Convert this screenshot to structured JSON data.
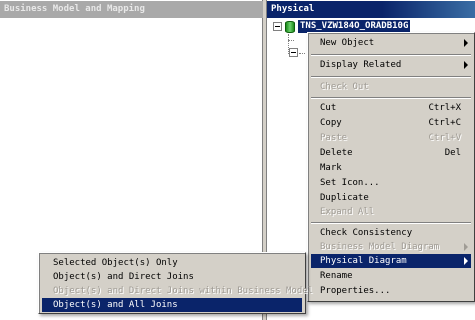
{
  "left_pane": {
    "title": "Business Model and Mapping"
  },
  "right_pane": {
    "title": "Physical",
    "tree": {
      "selected_node": "TNS_VZW184O_ORADB10G"
    }
  },
  "context_menu": {
    "items": [
      {
        "label": "New Object",
        "submenu": true,
        "disabled": false
      },
      {
        "label": "Display Related",
        "submenu": true,
        "disabled": false
      },
      {
        "label": "Check Out",
        "disabled": true
      },
      {
        "label": "Cut",
        "shortcut": "Ctrl+X",
        "disabled": false
      },
      {
        "label": "Copy",
        "shortcut": "Ctrl+C",
        "disabled": false
      },
      {
        "label": "Paste",
        "shortcut": "Ctrl+V",
        "disabled": true
      },
      {
        "label": "Delete",
        "shortcut": "Del",
        "disabled": false
      },
      {
        "label": "Mark",
        "disabled": false
      },
      {
        "label": "Set Icon...",
        "disabled": false
      },
      {
        "label": "Duplicate",
        "disabled": false
      },
      {
        "label": "Expand All",
        "disabled": true
      },
      {
        "label": "Check Consistency",
        "disabled": false
      },
      {
        "label": "Business Model Diagram",
        "submenu": true,
        "disabled": true
      },
      {
        "label": "Physical Diagram",
        "submenu": true,
        "highlighted": true
      },
      {
        "label": "Rename",
        "disabled": false
      },
      {
        "label": "Properties...",
        "disabled": false
      }
    ]
  },
  "sub_menu": {
    "items": [
      {
        "label": "Selected Object(s) Only",
        "disabled": false
      },
      {
        "label": "Object(s) and Direct Joins",
        "disabled": false
      },
      {
        "label": "Object(s) and Direct Joins within Business Model",
        "disabled": true
      },
      {
        "label": "Object(s) and All Joins",
        "highlighted": true
      }
    ]
  }
}
